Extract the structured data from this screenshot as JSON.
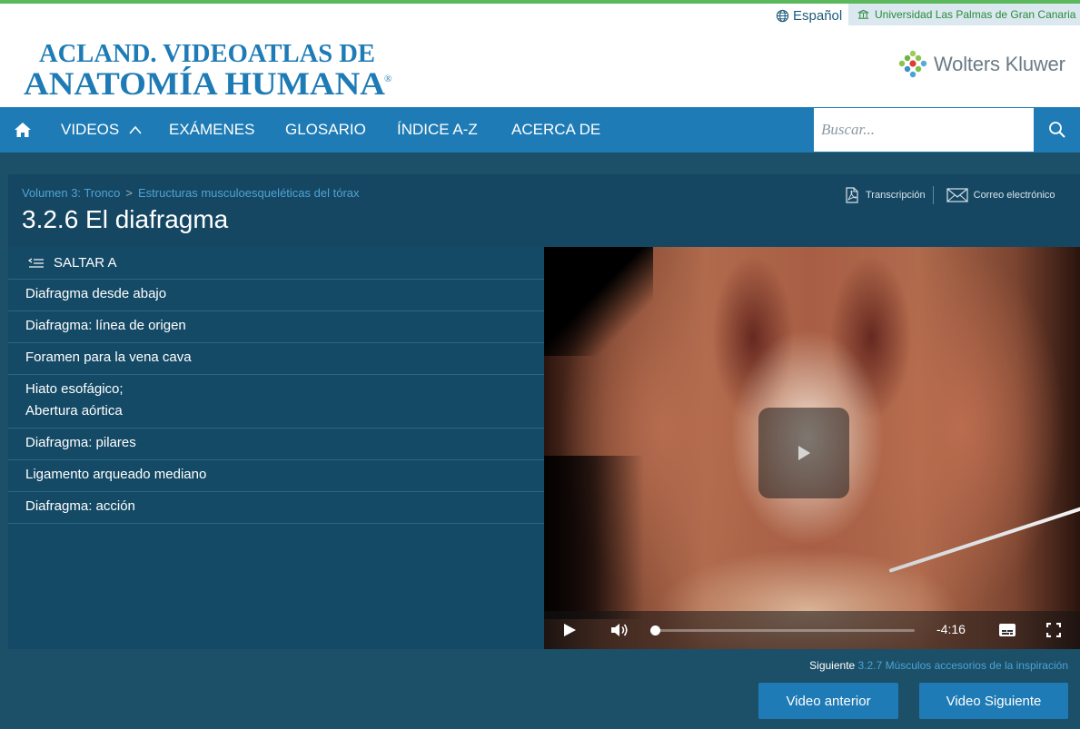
{
  "header": {
    "language": "Español",
    "institution": "Universidad Las Palmas de Gran Canaria",
    "logo_line1": "ACLAND. VIDEOATLAS DE",
    "logo_line2": "ANATOMÍA HUMANA",
    "logo_mark": "®",
    "publisher": "Wolters Kluwer"
  },
  "nav": {
    "items": [
      {
        "label": "VIDEOS"
      },
      {
        "label": "EXÁMENES"
      },
      {
        "label": "GLOSARIO"
      },
      {
        "label": "ÍNDICE A-Z"
      },
      {
        "label": "ACERCA DE"
      }
    ],
    "search_placeholder": "Buscar..."
  },
  "page": {
    "breadcrumb": [
      "Volumen 3: Tronco",
      "Estructuras musculoesqueléticas del tórax"
    ],
    "breadcrumb_sep": ">",
    "title": "3.2.6 El diafragma",
    "tools": {
      "transcript": "Transcripción",
      "email": "Correo electrónico"
    }
  },
  "chapters": {
    "skip_label": "SALTAR A",
    "items": [
      {
        "lines": [
          "Diafragma desde abajo"
        ]
      },
      {
        "lines": [
          "Diafragma: línea de origen"
        ]
      },
      {
        "lines": [
          "Foramen para la vena cava"
        ]
      },
      {
        "lines": [
          "Hiato esofágico;",
          "Abertura aórtica"
        ]
      },
      {
        "lines": [
          "Diafragma: pilares"
        ]
      },
      {
        "lines": [
          "Ligamento arqueado mediano"
        ]
      },
      {
        "lines": [
          "Diafragma: acción"
        ]
      }
    ]
  },
  "player": {
    "time_remaining": "-4:16",
    "progress": 0.0
  },
  "footer": {
    "next_prefix": "Siguiente",
    "next_title": "3.2.7 Músculos accesorios de la inspiración",
    "prev_button": "Video anterior",
    "next_button": "Video Siguiente"
  },
  "colors": {
    "nav_blue": "#1e7bb5",
    "band": "#1c4f68",
    "link_blue": "#4ca3d6",
    "green_accent": "#5cb85c"
  }
}
